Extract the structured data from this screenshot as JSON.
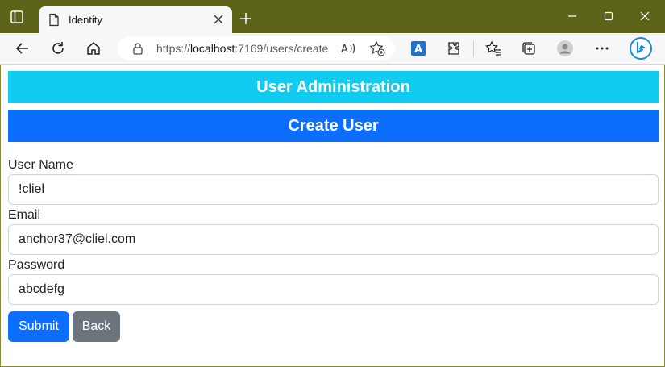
{
  "browser": {
    "tab_title": "Identity",
    "url_prefix": "https://",
    "url_host": "localhost",
    "url_rest": ":7169/users/create",
    "translate_label": "A",
    "accent_color": "#0d6efd"
  },
  "page": {
    "admin_heading": "User Administration",
    "create_heading": "Create User",
    "form": {
      "username": {
        "label": "User Name",
        "value": "!cliel"
      },
      "email": {
        "label": "Email",
        "value": "anchor37@cliel.com"
      },
      "password": {
        "label": "Password",
        "value": "abcdefg"
      }
    },
    "buttons": {
      "submit": "Submit",
      "back": "Back"
    }
  }
}
